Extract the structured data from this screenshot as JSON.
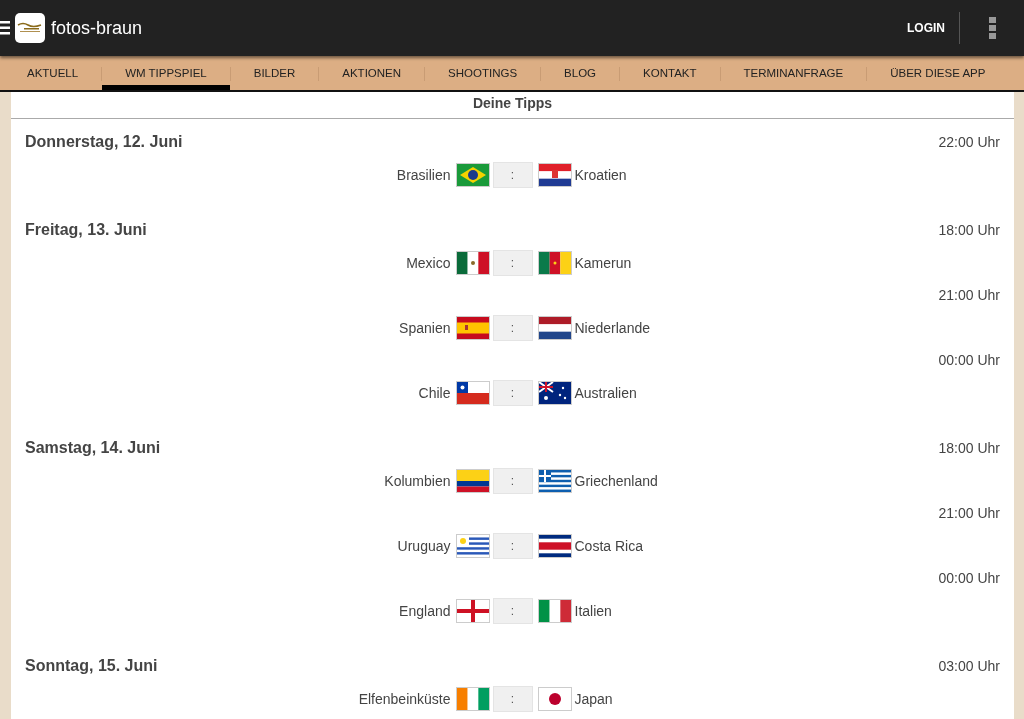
{
  "app_bar": {
    "title": "fotos-braun",
    "login": "LOGIN"
  },
  "nav": [
    {
      "label": "AKTUELL",
      "selected": false
    },
    {
      "label": "WM TIPPSPIEL",
      "selected": true
    },
    {
      "label": "BILDER",
      "selected": false
    },
    {
      "label": "AKTIONEN",
      "selected": false
    },
    {
      "label": "SHOOTINGS",
      "selected": false
    },
    {
      "label": "BLOG",
      "selected": false
    },
    {
      "label": "KONTAKT",
      "selected": false
    },
    {
      "label": "TERMINANFRAGE",
      "selected": false
    },
    {
      "label": "ÜBER DIESE APP",
      "selected": false
    }
  ],
  "panel_title": "Deine Tipps",
  "days": [
    {
      "date": "Donnerstag, 12. Juni",
      "matches": [
        {
          "time": "22:00 Uhr",
          "home": "Brasilien",
          "home_flag": {
            "kind": "br"
          },
          "separator": ":",
          "away": "Kroatien",
          "away_flag": {
            "kind": "hr"
          }
        }
      ]
    },
    {
      "date": "Freitag, 13. Juni",
      "matches": [
        {
          "time": "18:00 Uhr",
          "home": "Mexico",
          "home_flag": {
            "kind": "mx"
          },
          "separator": ":",
          "away": "Kamerun",
          "away_flag": {
            "kind": "cm"
          }
        },
        {
          "time": "21:00 Uhr",
          "home": "Spanien",
          "home_flag": {
            "kind": "es"
          },
          "separator": ":",
          "away": "Niederlande",
          "away_flag": {
            "kind": "nl"
          }
        },
        {
          "time": "00:00 Uhr",
          "home": "Chile",
          "home_flag": {
            "kind": "cl"
          },
          "separator": ":",
          "away": "Australien",
          "away_flag": {
            "kind": "au"
          }
        }
      ]
    },
    {
      "date": "Samstag, 14. Juni",
      "matches": [
        {
          "time": "18:00 Uhr",
          "home": "Kolumbien",
          "home_flag": {
            "kind": "co"
          },
          "separator": ":",
          "away": "Griechenland",
          "away_flag": {
            "kind": "gr"
          }
        },
        {
          "time": "21:00 Uhr",
          "home": "Uruguay",
          "home_flag": {
            "kind": "uy"
          },
          "separator": ":",
          "away": "Costa Rica",
          "away_flag": {
            "kind": "cr"
          }
        },
        {
          "time": "00:00 Uhr",
          "home": "England",
          "home_flag": {
            "kind": "en"
          },
          "separator": ":",
          "away": "Italien",
          "away_flag": {
            "kind": "it"
          }
        }
      ]
    },
    {
      "date": "Sonntag, 15. Juni",
      "matches": [
        {
          "time": "03:00 Uhr",
          "home": "Elfenbeinküste",
          "home_flag": {
            "kind": "ci"
          },
          "separator": ":",
          "away": "Japan",
          "away_flag": {
            "kind": "jp"
          }
        }
      ]
    }
  ]
}
